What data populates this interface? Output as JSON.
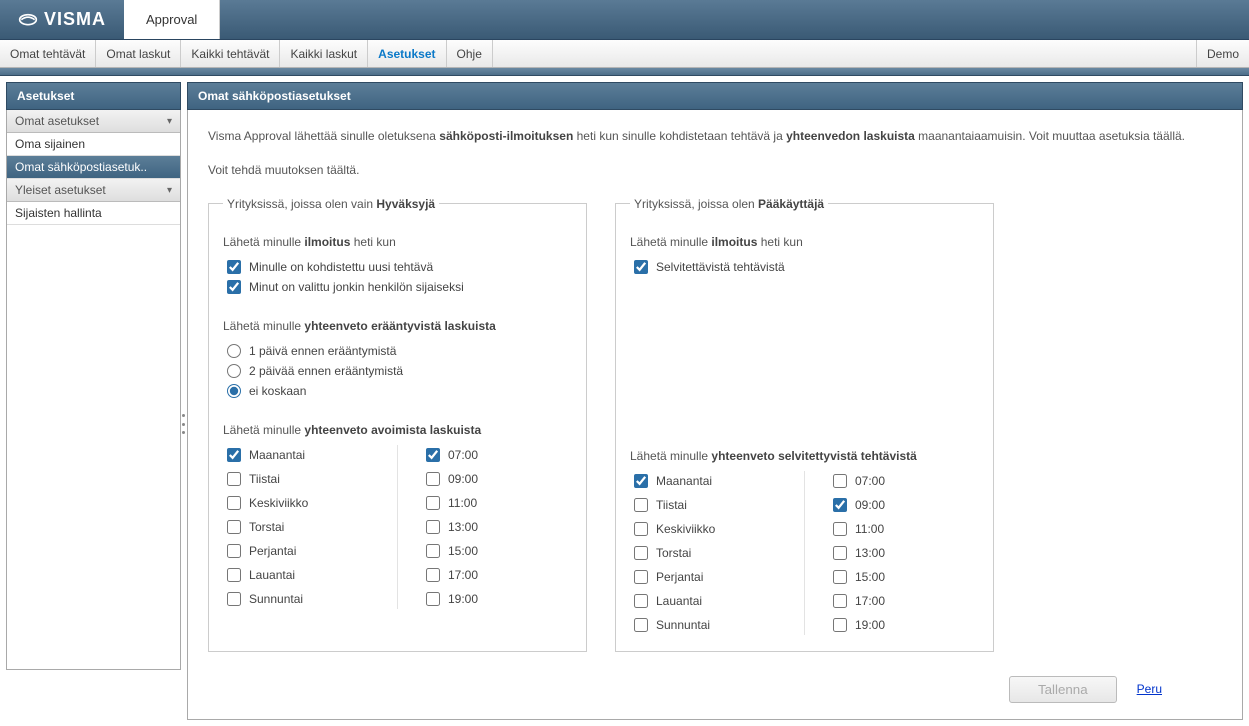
{
  "header": {
    "brand": "VISMA",
    "app_tab": "Approval"
  },
  "menubar": {
    "items": [
      {
        "label": "Omat tehtävät"
      },
      {
        "label": "Omat laskut"
      },
      {
        "label": "Kaikki tehtävät"
      },
      {
        "label": "Kaikki laskut"
      },
      {
        "label": "Asetukset",
        "active": true
      },
      {
        "label": "Ohje"
      }
    ],
    "right": {
      "label": "Demo"
    }
  },
  "sidebar": {
    "title": "Asetukset",
    "groups": [
      {
        "label": "Omat asetukset",
        "expanded": true
      },
      {
        "label": "Yleiset asetukset",
        "expanded": false
      }
    ],
    "items_group1": [
      {
        "label": "Oma sijainen"
      },
      {
        "label": "Omat sähköpostiasetuk..",
        "active": true
      }
    ],
    "items_group2": [
      {
        "label": "Sijaisten hallinta"
      }
    ]
  },
  "main": {
    "title": "Omat sähköpostiasetukset",
    "intro_pre": "Visma Approval lähettää sinulle oletuksena ",
    "intro_b1": "sähköposti-ilmoituksen",
    "intro_mid": " heti kun sinulle kohdistetaan tehtävä ja ",
    "intro_b2": "yhteenvedon laskuista",
    "intro_post": " maanantaiaamuisin. Voit muuttaa asetuksia täällä.",
    "intro_line2": "Voit tehdä muutoksen täältä."
  },
  "box_approver": {
    "legend_pre": "Yrityksissä, joissa olen vain ",
    "legend_b": "Hyväksyjä",
    "notif_head_pre": "Lähetä minulle ",
    "notif_head_b": "ilmoitus",
    "notif_head_post": " heti kun",
    "notif_opts": [
      {
        "label": "Minulle on kohdistettu uusi tehtävä",
        "checked": true
      },
      {
        "label": "Minut on valittu jonkin henkilön sijaiseksi",
        "checked": true
      }
    ],
    "summary1_head_pre": "Lähetä minulle ",
    "summary1_head_b": "yhteenveto erääntyvistä laskuista",
    "summary1_radios": [
      {
        "label": "1 päivä ennen erääntymistä",
        "checked": false
      },
      {
        "label": "2 päivää ennen erääntymistä",
        "checked": false
      },
      {
        "label": "ei koskaan",
        "checked": true
      }
    ],
    "summary2_head_pre": "Lähetä minulle ",
    "summary2_head_b": "yhteenveto avoimista laskuista",
    "days": [
      {
        "label": "Maanantai",
        "checked": true
      },
      {
        "label": "Tiistai",
        "checked": false
      },
      {
        "label": "Keskiviikko",
        "checked": false
      },
      {
        "label": "Torstai",
        "checked": false
      },
      {
        "label": "Perjantai",
        "checked": false
      },
      {
        "label": "Lauantai",
        "checked": false
      },
      {
        "label": "Sunnuntai",
        "checked": false
      }
    ],
    "times": [
      {
        "label": "07:00",
        "checked": true
      },
      {
        "label": "09:00",
        "checked": false
      },
      {
        "label": "11:00",
        "checked": false
      },
      {
        "label": "13:00",
        "checked": false
      },
      {
        "label": "15:00",
        "checked": false
      },
      {
        "label": "17:00",
        "checked": false
      },
      {
        "label": "19:00",
        "checked": false
      }
    ]
  },
  "box_admin": {
    "legend_pre": "Yrityksissä, joissa olen ",
    "legend_b": "Pääkäyttäjä",
    "notif_head_pre": "Lähetä minulle ",
    "notif_head_b": "ilmoitus",
    "notif_head_post": " heti kun",
    "notif_opts": [
      {
        "label": "Selvitettävistä tehtävistä",
        "checked": true
      }
    ],
    "summary_head_pre": "Lähetä minulle ",
    "summary_head_b": "yhteenveto selvitettyvistä tehtävistä",
    "days": [
      {
        "label": "Maanantai",
        "checked": true
      },
      {
        "label": "Tiistai",
        "checked": false
      },
      {
        "label": "Keskiviikko",
        "checked": false
      },
      {
        "label": "Torstai",
        "checked": false
      },
      {
        "label": "Perjantai",
        "checked": false
      },
      {
        "label": "Lauantai",
        "checked": false
      },
      {
        "label": "Sunnuntai",
        "checked": false
      }
    ],
    "times": [
      {
        "label": "07:00",
        "checked": false
      },
      {
        "label": "09:00",
        "checked": true
      },
      {
        "label": "11:00",
        "checked": false
      },
      {
        "label": "13:00",
        "checked": false
      },
      {
        "label": "15:00",
        "checked": false
      },
      {
        "label": "17:00",
        "checked": false
      },
      {
        "label": "19:00",
        "checked": false
      }
    ]
  },
  "actions": {
    "save": "Tallenna",
    "cancel": "Peru"
  }
}
